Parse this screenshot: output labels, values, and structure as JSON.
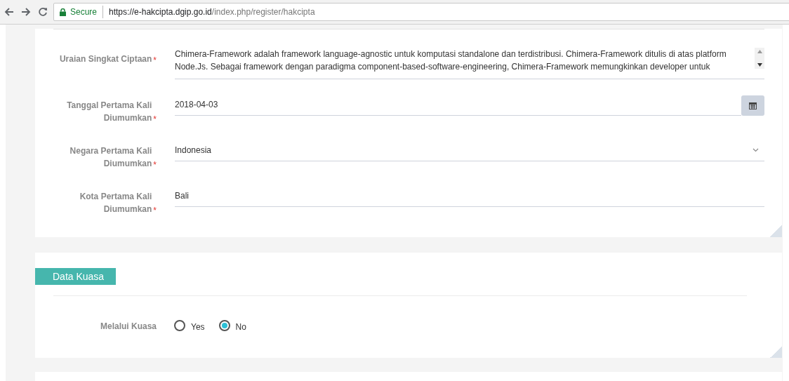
{
  "browser": {
    "secure_label": "Secure",
    "url_host": "https://e-hakcipta.dgip.go.id",
    "url_path": "/index.php/register/hakcipta"
  },
  "fields": [
    {
      "kind": "textarea",
      "label": "Uraian Singkat Ciptaan",
      "required_mark": "*",
      "value": "Chimera-Framework adalah framework language-agnostic untuk komputasi standalone dan terdistribusi. Chimera-Framework ditulis di atas platform Node.Js. Sebagai framework dengan paradigma component-based-software-engineering, Chimera-Framework memungkinkan developer untuk"
    },
    {
      "kind": "date",
      "label": "Tanggal Pertama Kali Diumumkan",
      "required_mark": "*",
      "value": "2018-04-03"
    },
    {
      "kind": "select",
      "label": "Negara Pertama Kali Diumumkan",
      "required_mark": "*",
      "value": "Indonesia"
    },
    {
      "kind": "text",
      "label": "Kota Pertama Kali Diumumkan",
      "required_mark": "*",
      "value": "Bali"
    }
  ],
  "kuasa": {
    "title": "Data Kuasa",
    "label": "Melalui Kuasa",
    "options": [
      {
        "label": "Yes",
        "selected": false
      },
      {
        "label": "No",
        "selected": true
      }
    ]
  }
}
